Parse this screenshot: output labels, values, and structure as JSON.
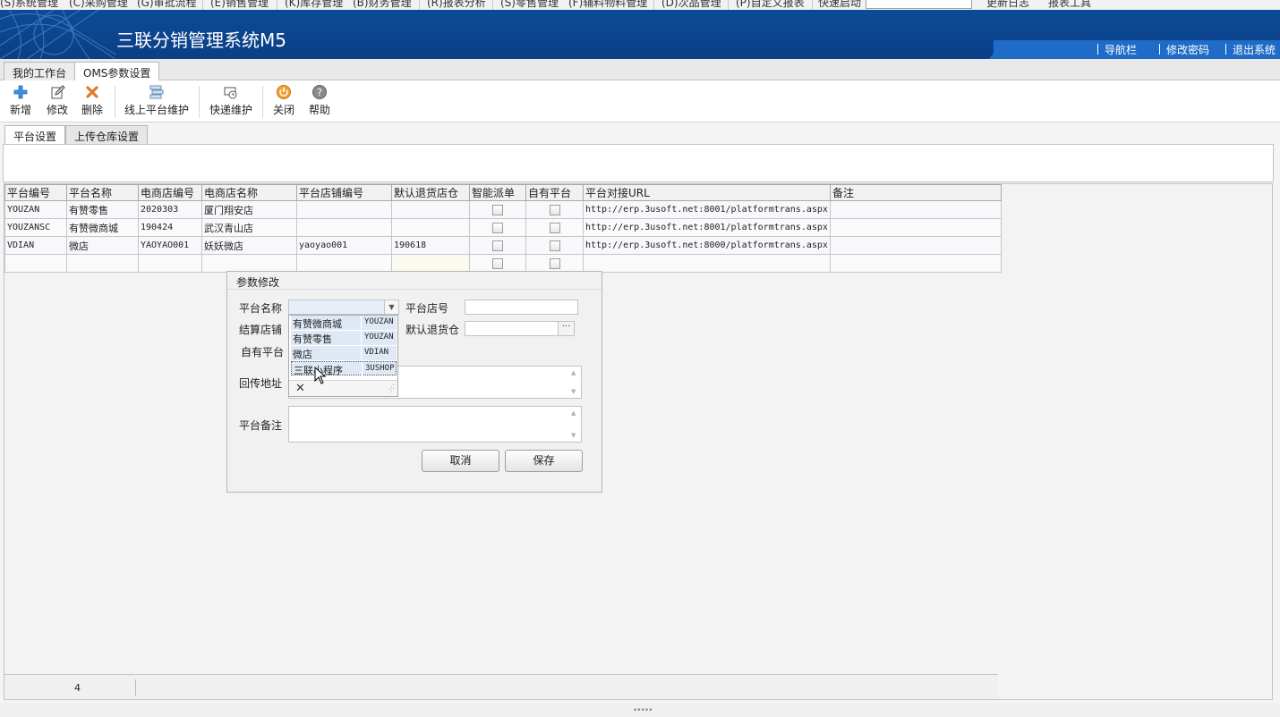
{
  "menu": {
    "items": [
      "(S)系统管理",
      "(C)采购管理",
      "(G)审批流程",
      "(E)销售管理",
      "(K)库存管理",
      "(B)财务管理",
      "(R)报表分析",
      "(S)零售管理",
      "(F)辅料物料管理",
      "(D)次品管理",
      "(P)自定义报表"
    ],
    "quick_launch_label": "快速启动",
    "quick_launch_value": "",
    "update_log": "更新日志",
    "report_tool": "报表工具"
  },
  "header": {
    "title": "三联分销管理系统M5",
    "links": [
      "导航栏",
      "修改密码",
      "退出系统"
    ]
  },
  "doc_tabs": [
    "我的工作台",
    "OMS参数设置"
  ],
  "toolbar": {
    "buttons": [
      {
        "label": "新增",
        "icon": "plus-icon"
      },
      {
        "label": "修改",
        "icon": "edit-icon"
      },
      {
        "label": "删除",
        "icon": "delete-icon"
      },
      {
        "label": "线上平台维护",
        "icon": "platform-icon"
      },
      {
        "label": "快递维护",
        "icon": "express-icon"
      },
      {
        "label": "关闭",
        "icon": "power-icon"
      },
      {
        "label": "帮助",
        "icon": "help-icon"
      }
    ]
  },
  "inner_tabs": [
    "平台设置",
    "上传仓库设置"
  ],
  "grid": {
    "columns": [
      "平台编号",
      "平台名称",
      "电商店编号",
      "电商店名称",
      "平台店铺编号",
      "默认退货店仓",
      "智能派单",
      "自有平台",
      "平台对接URL",
      "备注"
    ],
    "rows": [
      {
        "code": "YOUZAN",
        "name": "有赞零售",
        "shop_no": "2020303",
        "shop_name": "厦门翔安店",
        "platform_shop_no": "",
        "return_store": "",
        "smart": false,
        "own": false,
        "url": "http://erp.3usoft.net:8001/platformtrans.aspx",
        "remark": ""
      },
      {
        "code": "YOUZANSC",
        "name": "有赞微商城",
        "shop_no": "190424",
        "shop_name": "武汉青山店",
        "platform_shop_no": "",
        "return_store": "",
        "smart": false,
        "own": false,
        "url": "http://erp.3usoft.net:8001/platformtrans.aspx",
        "remark": ""
      },
      {
        "code": "VDIAN",
        "name": "微店",
        "shop_no": "YAOYAO001",
        "shop_name": "妖妖微店",
        "platform_shop_no": "yaoyao001",
        "return_store": "190618",
        "smart": false,
        "own": false,
        "url": "http://erp.3usoft.net:8000/platformtrans.aspx",
        "remark": ""
      }
    ],
    "row_count": "4"
  },
  "dialog": {
    "title": "参数修改",
    "labels": {
      "platform_name": "平台名称",
      "platform_shop": "平台店号",
      "settle_shop": "结算店铺",
      "default_return": "默认退货仓",
      "own_platform": "自有平台",
      "callback_url": "回传地址",
      "remark": "平台备注"
    },
    "values": {
      "platform_name": "",
      "platform_shop": "",
      "default_return": ""
    },
    "buttons": {
      "cancel": "取消",
      "save": "保存"
    },
    "dropdown_options": [
      {
        "name": "有赞微商城",
        "code": "YOUZAN"
      },
      {
        "name": "有赞零售",
        "code": "YOUZAN"
      },
      {
        "name": "微店",
        "code": "VDIAN"
      },
      {
        "name": "三联小程序",
        "code": "3USHOP"
      }
    ]
  }
}
